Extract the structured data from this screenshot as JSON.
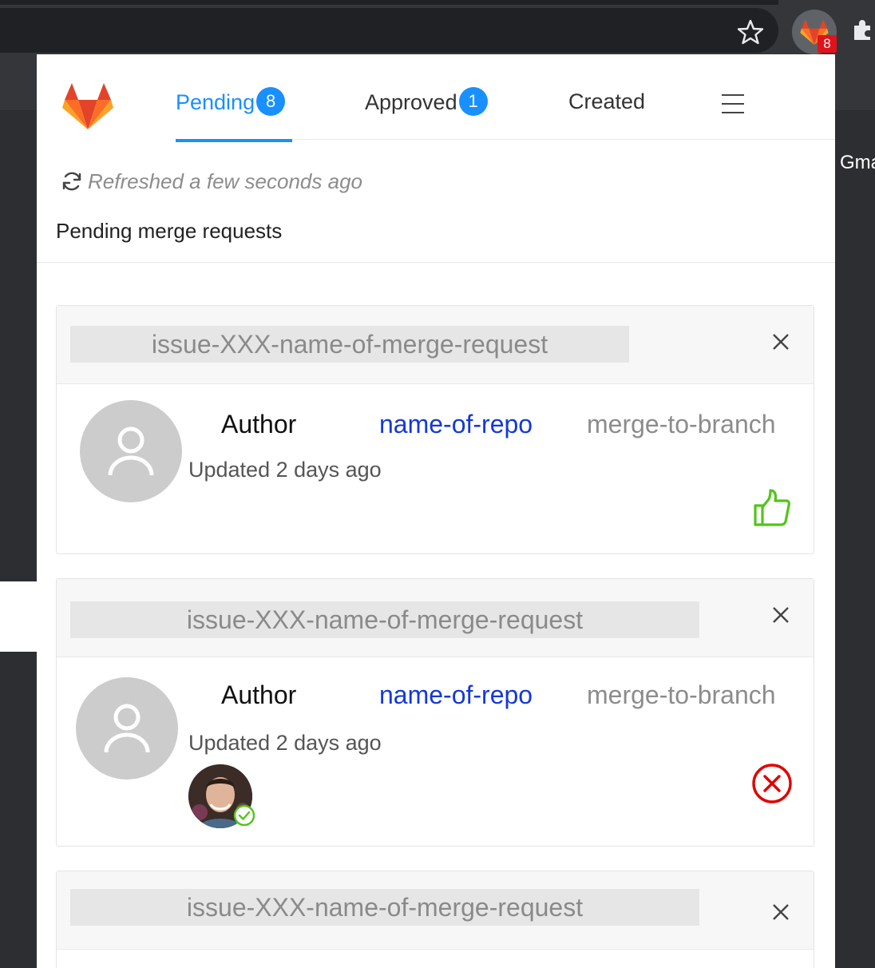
{
  "browser": {
    "extension_badge": "8",
    "background_text": "Gma"
  },
  "tabs": [
    {
      "label": "Pending",
      "count": "8",
      "active": true
    },
    {
      "label": "Approved",
      "count": "1",
      "active": false
    },
    {
      "label": "Created",
      "count": null,
      "active": false
    }
  ],
  "status": {
    "refreshed": "Refreshed a few seconds ago"
  },
  "section": {
    "title": "Pending merge requests"
  },
  "merge_requests": [
    {
      "title": "issue-XXX-name-of-merge-request",
      "author": "Author",
      "repo": "name-of-repo",
      "branch": "merge-to-branch",
      "updated": "Updated 2 days ago",
      "close": "X",
      "action": "thumbs-up-icon"
    },
    {
      "title": "issue-XXX-name-of-merge-request",
      "author": "Author",
      "repo": "name-of-repo",
      "branch": "merge-to-branch",
      "updated": "Updated 2 days ago",
      "close": "X",
      "action": "reject-circle-icon",
      "reviewer_approved": true
    },
    {
      "title": "issue-XXX-name-of-merge-request",
      "close": "X"
    }
  ],
  "colors": {
    "accent": "#1890ff",
    "repo_link": "#1439d8",
    "approve": "#52c41a",
    "reject": "#e00000"
  }
}
